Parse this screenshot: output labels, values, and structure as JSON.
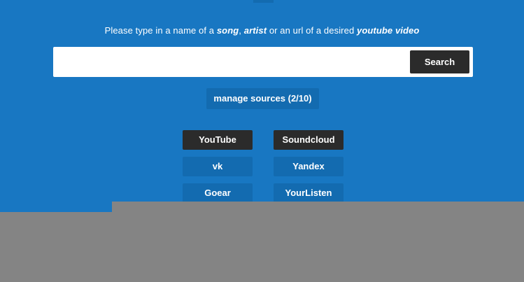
{
  "instruction": {
    "part1": "Please type in a name of a ",
    "song": "song",
    "sep1": ", ",
    "artist": "artist",
    "part2": " or an url of a desired ",
    "video": "youtube video"
  },
  "search": {
    "value": "",
    "placeholder": "",
    "button_label": "Search"
  },
  "manage_sources": {
    "label": "manage sources (2/10)"
  },
  "sources": [
    {
      "label": "YouTube",
      "active": true
    },
    {
      "label": "Soundcloud",
      "active": true
    },
    {
      "label": "vk",
      "active": false
    },
    {
      "label": "Yandex",
      "active": false
    },
    {
      "label": "Goear",
      "active": false
    },
    {
      "label": "YourListen",
      "active": false
    }
  ],
  "colors": {
    "panel_blue": "#1877c2",
    "button_blue": "#136bb0",
    "active_dark": "#2b2b2b",
    "overlay_gray": "#848484"
  }
}
